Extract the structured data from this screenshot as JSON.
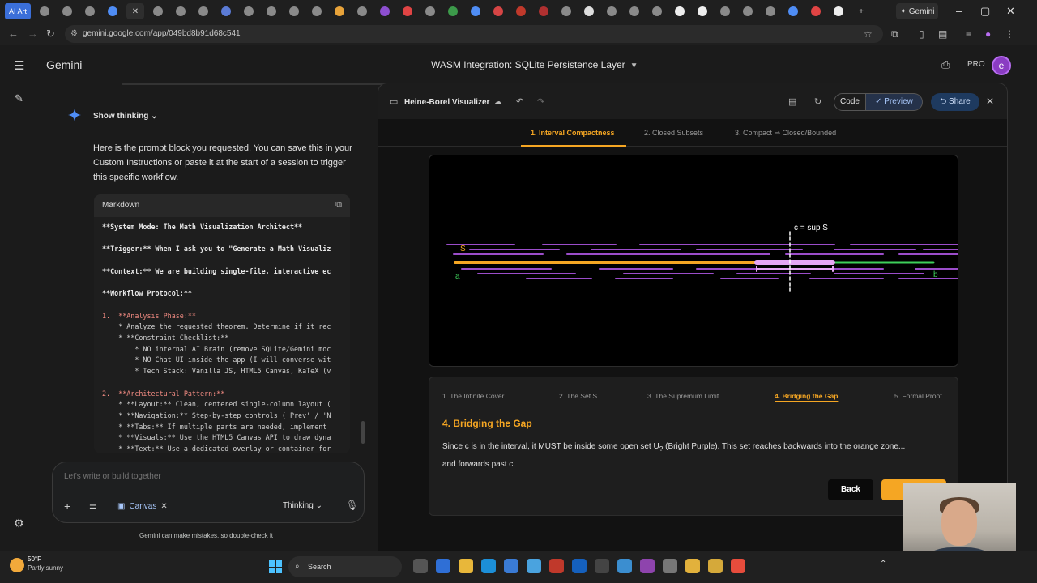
{
  "browser": {
    "ai_art_tab": "AI Art",
    "gemini_chip": "Gemini",
    "url": "gemini.google.com/app/049bd8b91d68c541",
    "window_controls": [
      "–",
      "▢",
      "✕"
    ]
  },
  "app": {
    "brand": "Gemini",
    "chat_title": "WASM Integration: SQLite Persistence Layer",
    "plan": "PRO",
    "avatar_letter": "e"
  },
  "chat": {
    "show_thinking": "Show thinking",
    "intro": "Here is the prompt block you requested. You can save this in your Custom Instructions or paste it at the start of a session to trigger this specific workflow.",
    "code_block": {
      "language": "Markdown",
      "lines": [
        "**System Mode: The Math Visualization Architect**",
        "",
        "**Trigger:** When I ask you to \"Generate a Math Visualiz",
        "",
        "**Context:** We are building single-file, interactive ec",
        "",
        "**Workflow Protocol:**",
        "",
        "1.  **Analysis Phase:**",
        "    * Analyze the requested theorem. Determine if it rec",
        "    * **Constraint Checklist:**",
        "        * NO internal AI Brain (remove SQLite/Gemini moc",
        "        * NO Chat UI inside the app (I will converse wit",
        "        * Tech Stack: Vanilla JS, HTML5 Canvas, KaTeX (v",
        "",
        "2.  **Architectural Pattern:**",
        "    * **Layout:** Clean, centered single-column layout (",
        "    * **Navigation:** Step-by-step controls ('Prev' / 'N",
        "    * **Tabs:** If multiple parts are needed, implement",
        "    * **Visuals:** Use the HTML5 Canvas API to draw dyna",
        "    * **Text:** Use a dedicated overlay or container for"
      ]
    },
    "composer_placeholder": "Let's write or build together",
    "canvas_chip": "Canvas",
    "thinking_label": "Thinking",
    "disclaimer": "Gemini can make mistakes, so double-check it"
  },
  "panel": {
    "title": "Heine-Borel Visualizer",
    "code_label": "Code",
    "preview_label": "Preview",
    "share_label": "Share",
    "tabs": [
      "1. Interval Compactness",
      "2. Closed Subsets",
      "3. Compact ⇒ Closed/Bounded"
    ],
    "active_tab_index": 0,
    "viz": {
      "sup_label": "c = sup S",
      "s_label": "S",
      "a_label": "a",
      "b_label": "b",
      "colors": {
        "cover": "#9b4dca",
        "set_s": "#f5a623",
        "green": "#3ecf5a",
        "highlight": "#e6a6f5"
      }
    },
    "steps": [
      "1. The Infinite Cover",
      "2. The Set S",
      "3. The Supremum Limit",
      "4. Bridging the Gap",
      "5. Formal Proof"
    ],
    "active_step_index": 3,
    "step_heading": "4. Bridging the Gap",
    "step_body_1": "Since c is in the interval, it MUST be inside some open set U",
    "step_body_sub": "?",
    "step_body_2": " (Bright Purple). This set reaches backwards into the orange zone...",
    "step_body_3": "and forwards past c.",
    "back_label": "Back",
    "next_label": "Next"
  },
  "taskbar": {
    "temp": "50°F",
    "weather": "Partly sunny",
    "search": "Search"
  }
}
